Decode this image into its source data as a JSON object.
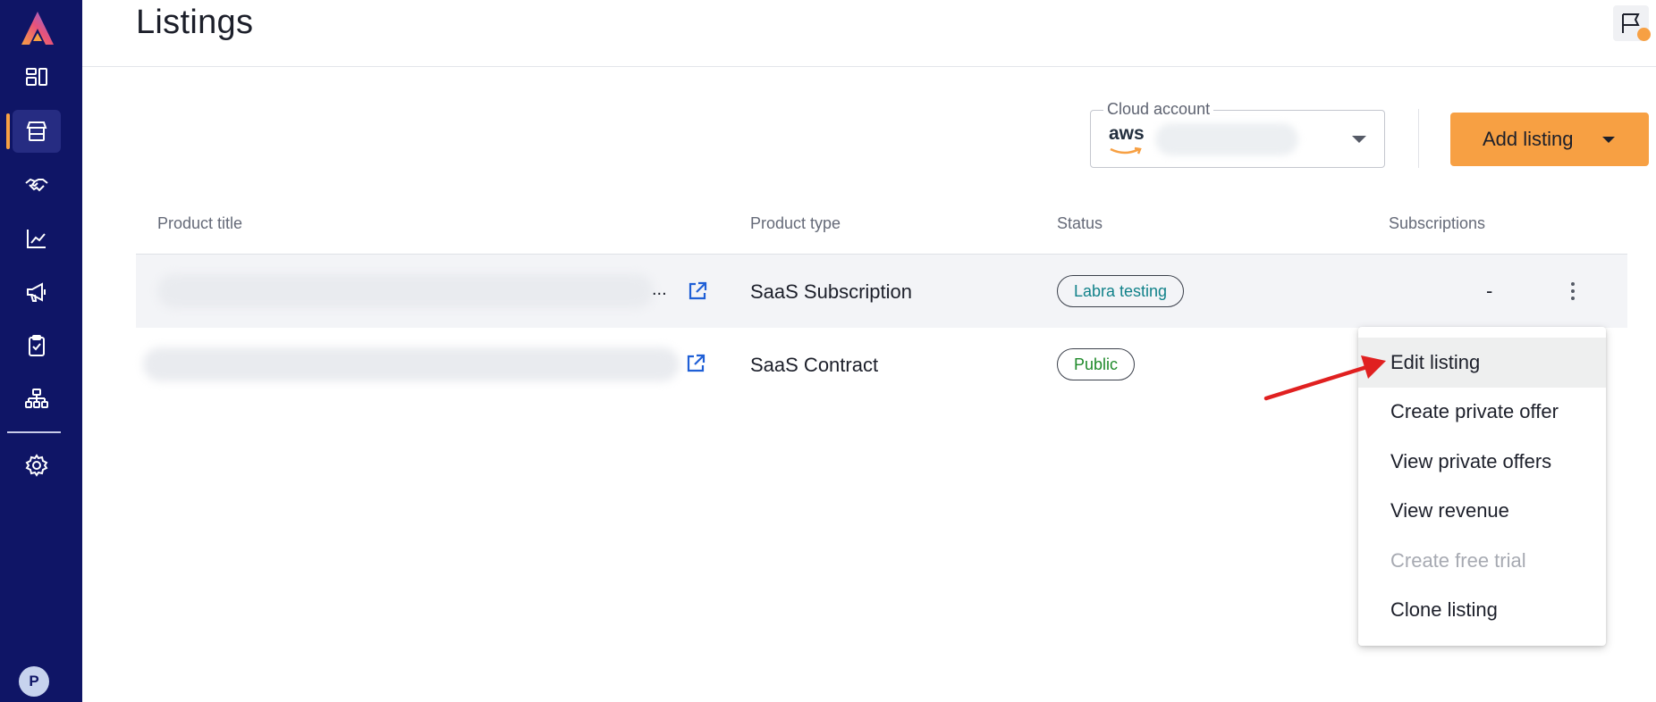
{
  "sidebar": {
    "items": [
      {
        "icon": "dashboard-icon",
        "active": false
      },
      {
        "icon": "storefront-icon",
        "active": true
      },
      {
        "icon": "handshake-icon",
        "active": false
      },
      {
        "icon": "chart-line-icon",
        "active": false
      },
      {
        "icon": "megaphone-icon",
        "active": false
      },
      {
        "icon": "clipboard-check-icon",
        "active": false
      },
      {
        "icon": "org-hierarchy-icon",
        "active": false
      },
      {
        "icon": "gear-icon",
        "active": false
      }
    ],
    "avatar_initial": "P"
  },
  "header": {
    "title": "Listings"
  },
  "toolbar": {
    "cloud_account_label": "Cloud account",
    "cloud_provider": "aws",
    "add_listing_label": "Add listing"
  },
  "table": {
    "columns": [
      "Product title",
      "Product type",
      "Status",
      "Subscriptions"
    ],
    "rows": [
      {
        "title_ellipsis": "...",
        "product_type": "SaaS Subscription",
        "status": "Labra testing",
        "subscriptions": "-"
      },
      {
        "title_ellipsis": "",
        "product_type": "SaaS Contract",
        "status": "Public",
        "subscriptions": ""
      }
    ]
  },
  "context_menu": {
    "items": [
      {
        "label": "Edit listing",
        "highlighted": true,
        "disabled": false
      },
      {
        "label": "Create private offer",
        "highlighted": false,
        "disabled": false
      },
      {
        "label": "View private offers",
        "highlighted": false,
        "disabled": false
      },
      {
        "label": "View revenue",
        "highlighted": false,
        "disabled": false
      },
      {
        "label": "Create free trial",
        "highlighted": false,
        "disabled": true
      },
      {
        "label": "Clone listing",
        "highlighted": false,
        "disabled": false
      }
    ]
  },
  "colors": {
    "sidebar_bg": "#0f1566",
    "accent": "#f7a043",
    "testing_badge": "#12828a",
    "public_badge": "#1f8a2a",
    "annotation_arrow": "#e02020"
  }
}
